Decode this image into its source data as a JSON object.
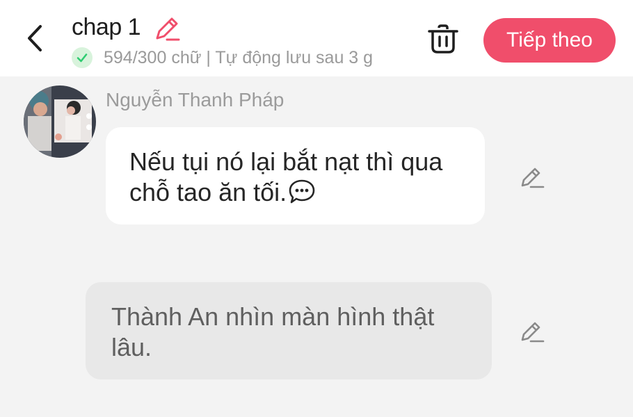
{
  "header": {
    "title": "chap 1",
    "status_text": "594/300 chữ | Tự động lưu sau 3 g",
    "next_label": "Tiếp theo"
  },
  "messages": [
    {
      "type": "dialogue",
      "speaker": "Nguyễn Thanh Pháp",
      "text": "Nếu tụi nó lại bắt nạt thì qua chỗ tao ăn tối."
    },
    {
      "type": "narration",
      "text": "Thành An nhìn màn hình thật lâu."
    }
  ],
  "icons": {
    "back": "chevron-left-icon",
    "title_edit": "pencil-icon",
    "status": "check-icon",
    "delete": "trash-icon",
    "message_edit": "pencil-icon",
    "dialogue": "speech-bubble-icon"
  },
  "colors": {
    "accent": "#f04e6b",
    "check": "#2ecc71",
    "background": "#f3f3f3"
  }
}
